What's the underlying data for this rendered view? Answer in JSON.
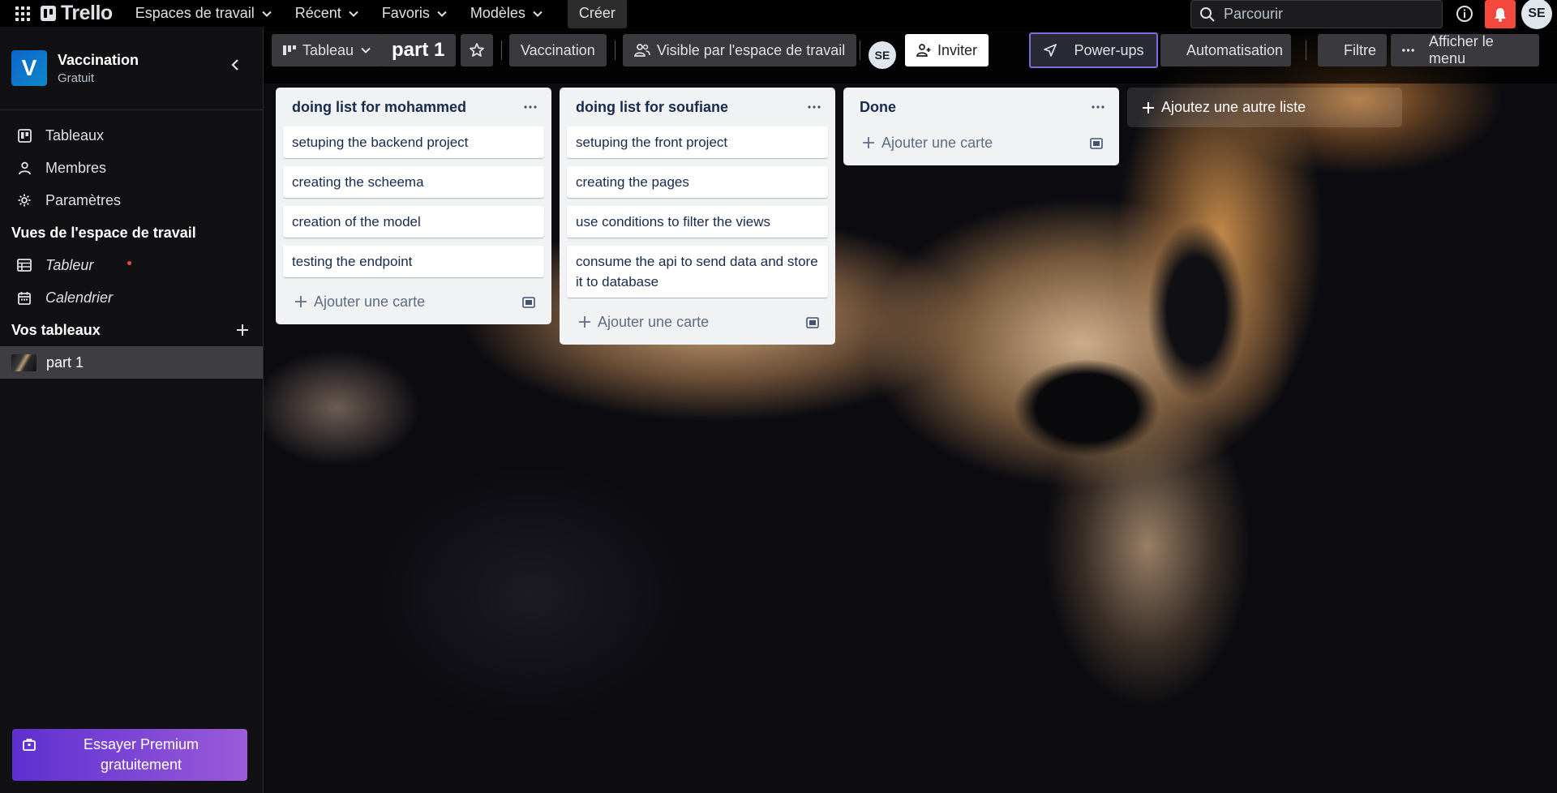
{
  "topbar": {
    "logo_text": "Trello",
    "nav": [
      {
        "label": "Espaces de travail"
      },
      {
        "label": "Récent"
      },
      {
        "label": "Favoris"
      },
      {
        "label": "Modèles"
      }
    ],
    "create_label": "Créer",
    "search_placeholder": "Parcourir",
    "avatar_initials": "SE",
    "notification_color": "#f4473e"
  },
  "sidebar": {
    "workspace": {
      "initial": "V",
      "name": "Vaccination",
      "plan": "Gratuit"
    },
    "links": [
      {
        "label": "Tableaux",
        "icon": "board-icon"
      },
      {
        "label": "Membres",
        "icon": "person-icon"
      },
      {
        "label": "Paramètres",
        "icon": "gear-icon"
      }
    ],
    "views_heading": "Vues de l'espace de travail",
    "views": [
      {
        "label": "Tableur",
        "icon": "table-icon"
      },
      {
        "label": "Calendrier",
        "icon": "calendar-icon"
      }
    ],
    "boards_heading": "Vos tableaux",
    "boards": [
      {
        "label": "part 1"
      }
    ],
    "premium_label": "Essayer Premium gratuitement"
  },
  "board": {
    "view_label": "Tableau",
    "title": "part 1",
    "workspace_label": "Vaccination",
    "visibility_label": "Visible par l'espace de travail",
    "member_initials": "SE",
    "invite_label": "Inviter",
    "powerups_label": "Power-ups",
    "automation_label": "Automatisation",
    "filter_label": "Filtre",
    "menu_label": "Afficher le menu",
    "accent_color": "#7a6cd9"
  },
  "lists": [
    {
      "title": "doing list for mohammed",
      "cards": [
        "setuping the backend project",
        "creating the scheema",
        "creation of the model",
        "testing the endpoint"
      ],
      "add_card_label": "Ajouter une carte"
    },
    {
      "title": "doing list for soufiane",
      "cards": [
        "setuping the front project",
        "creating the pages",
        "use conditions to filter the views",
        "consume the api to send data and store it to database"
      ],
      "add_card_label": "Ajouter une carte"
    },
    {
      "title": "Done",
      "cards": [],
      "add_card_label": "Ajouter une carte"
    }
  ],
  "add_list_label": "Ajoutez une autre liste"
}
